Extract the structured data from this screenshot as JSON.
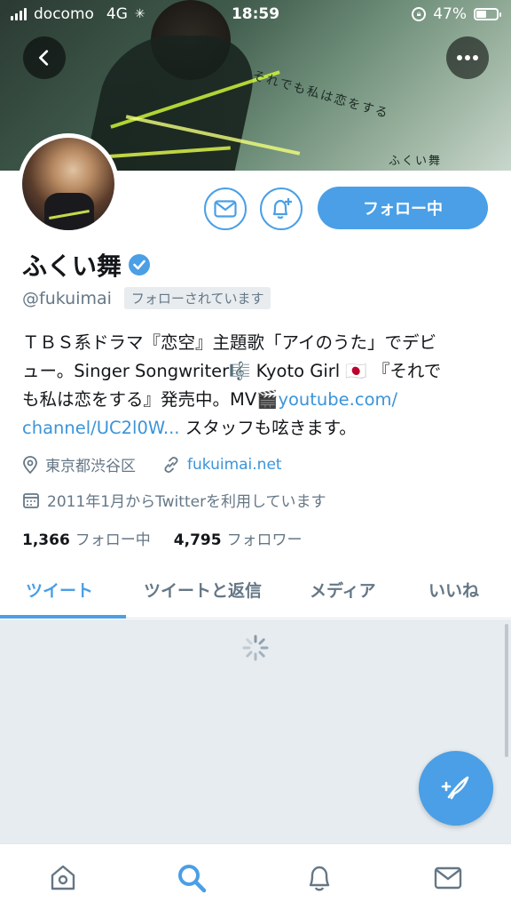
{
  "status_bar": {
    "carrier": "docomo",
    "network": "4G",
    "time": "18:59",
    "battery": "47%"
  },
  "profile": {
    "name": "ふくい舞",
    "handle": "@fukuimai",
    "follows_you": "フォローされています",
    "follow_button": "フォロー中",
    "bio_line1": "ＴＢＳ系ドラマ『恋空』主題歌「アイのうた」でデビ",
    "bio_line2": "ュー。Singer Songwriter🎼 Kyoto Girl 🇯🇵 『それで",
    "bio_line3": "も私は恋をする』発売中。MV🎬",
    "bio_link_a": "youtube.com/",
    "bio_link_b": "channel/UC2l0W...",
    "bio_line4_tail": " スタッフも呟きます。",
    "location": "東京都渋谷区",
    "website": "fukuimai.net",
    "joined": "2011年1月からTwitterを利用しています",
    "following_count": "1,366",
    "following_label": "フォロー中",
    "followers_count": "4,795",
    "followers_label": "フォロワー"
  },
  "banner": {
    "text": "それでも私は恋をする",
    "name": "ふくい舞"
  },
  "tabs": [
    {
      "label": "ツイート",
      "active": true
    },
    {
      "label": "ツイートと返信",
      "active": false
    },
    {
      "label": "メディア",
      "active": false
    },
    {
      "label": "いいね",
      "active": false
    }
  ],
  "nav": {
    "items": [
      "home-icon",
      "search-icon",
      "bell-icon",
      "mail-icon"
    ],
    "active": "search-icon"
  },
  "colors": {
    "accent": "#4a9fe6",
    "link": "#3b94d9",
    "muted": "#657786"
  }
}
